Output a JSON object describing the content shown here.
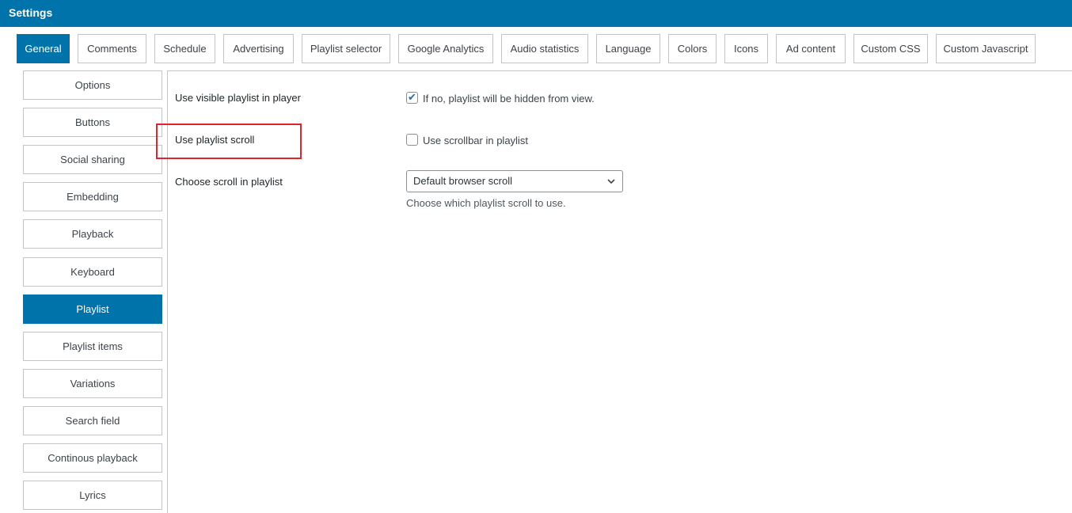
{
  "header": {
    "title": "Settings"
  },
  "tabs": [
    {
      "label": "General",
      "active": true
    },
    {
      "label": "Comments"
    },
    {
      "label": "Schedule"
    },
    {
      "label": "Advertising"
    },
    {
      "label": "Playlist selector"
    },
    {
      "label": "Google Analytics"
    },
    {
      "label": "Audio statistics"
    },
    {
      "label": "Language"
    },
    {
      "label": "Colors"
    },
    {
      "label": "Icons"
    },
    {
      "label": "Ad content"
    },
    {
      "label": "Custom CSS"
    },
    {
      "label": "Custom Javascript"
    }
  ],
  "sidebar": {
    "items": [
      {
        "label": "Options"
      },
      {
        "label": "Buttons"
      },
      {
        "label": "Social sharing"
      },
      {
        "label": "Embedding"
      },
      {
        "label": "Playback"
      },
      {
        "label": "Keyboard"
      },
      {
        "label": "Playlist",
        "active": true
      },
      {
        "label": "Playlist items"
      },
      {
        "label": "Variations"
      },
      {
        "label": "Search field"
      },
      {
        "label": "Continous playback"
      },
      {
        "label": "Lyrics"
      }
    ]
  },
  "settings": {
    "visible_playlist": {
      "label": "Use visible playlist in player",
      "checkbox_text": "If no, playlist will be hidden from view.",
      "checked": true
    },
    "playlist_scroll": {
      "label": "Use playlist scroll",
      "checkbox_text": "Use scrollbar in playlist",
      "checked": false
    },
    "scroll_type": {
      "label": "Choose scroll in playlist",
      "selected": "Default browser scroll",
      "description": "Choose which playlist scroll to use."
    }
  },
  "colors": {
    "accent": "#0073aa",
    "highlight": "#e0242b"
  }
}
